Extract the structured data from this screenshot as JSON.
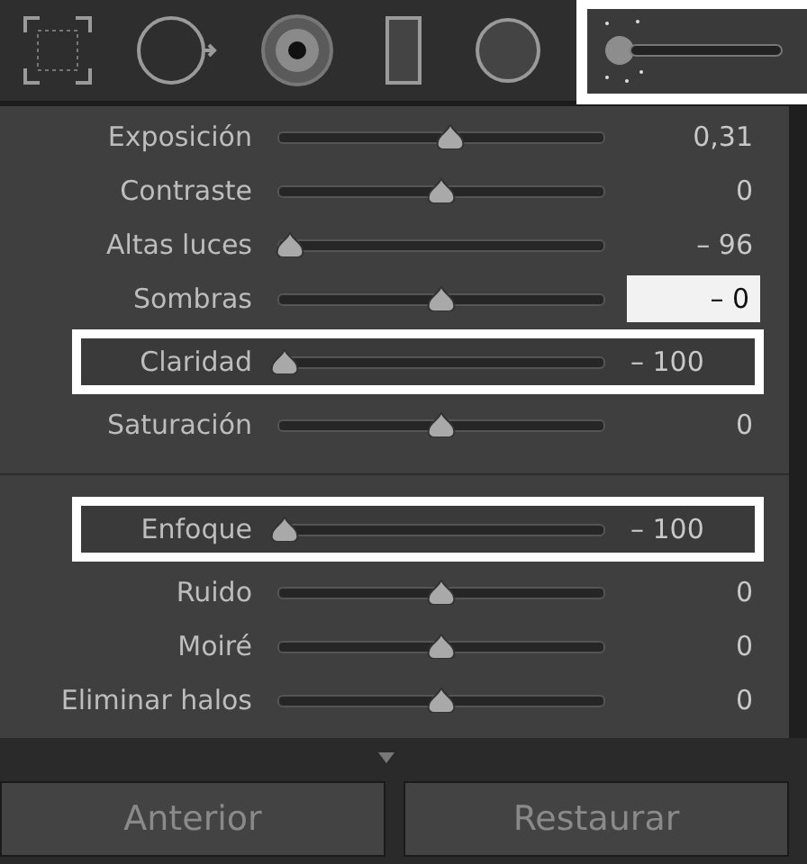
{
  "toolbar": {
    "tools": [
      {
        "kind": "marquee",
        "highlighted": false
      },
      {
        "kind": "spot",
        "highlighted": false
      },
      {
        "kind": "redeye",
        "highlighted": false
      },
      {
        "kind": "graduated",
        "highlighted": false
      },
      {
        "kind": "radial",
        "highlighted": false
      },
      {
        "kind": "brush",
        "highlighted": true
      }
    ]
  },
  "groups": [
    {
      "sliders": [
        {
          "label": "Exposición",
          "level": 0.53,
          "value": "0,31",
          "highlighted": false,
          "editing": false
        },
        {
          "label": "Contraste",
          "level": 0.5,
          "value": "0",
          "highlighted": false,
          "editing": false
        },
        {
          "label": "Altas luces",
          "level": 0.04,
          "value": "– 96",
          "highlighted": false,
          "editing": false
        },
        {
          "label": "Sombras",
          "level": 0.5,
          "value": "– 0",
          "highlighted": false,
          "editing": true
        },
        {
          "label": "Claridad",
          "level": 0.02,
          "value": "– 100",
          "highlighted": true,
          "editing": false
        },
        {
          "label": "Saturación",
          "level": 0.5,
          "value": "0",
          "highlighted": false,
          "editing": false
        }
      ]
    },
    {
      "sliders": [
        {
          "label": "Enfoque",
          "level": 0.02,
          "value": "– 100",
          "highlighted": true,
          "editing": false
        },
        {
          "label": "Ruido",
          "level": 0.5,
          "value": "0",
          "highlighted": false,
          "editing": false
        },
        {
          "label": "Moiré",
          "level": 0.5,
          "value": "0",
          "highlighted": false,
          "editing": false
        },
        {
          "label": "Eliminar halos",
          "level": 0.5,
          "value": "0",
          "highlighted": false,
          "editing": false
        }
      ]
    }
  ],
  "buttons": [
    "Anterior",
    "Restaurar"
  ]
}
